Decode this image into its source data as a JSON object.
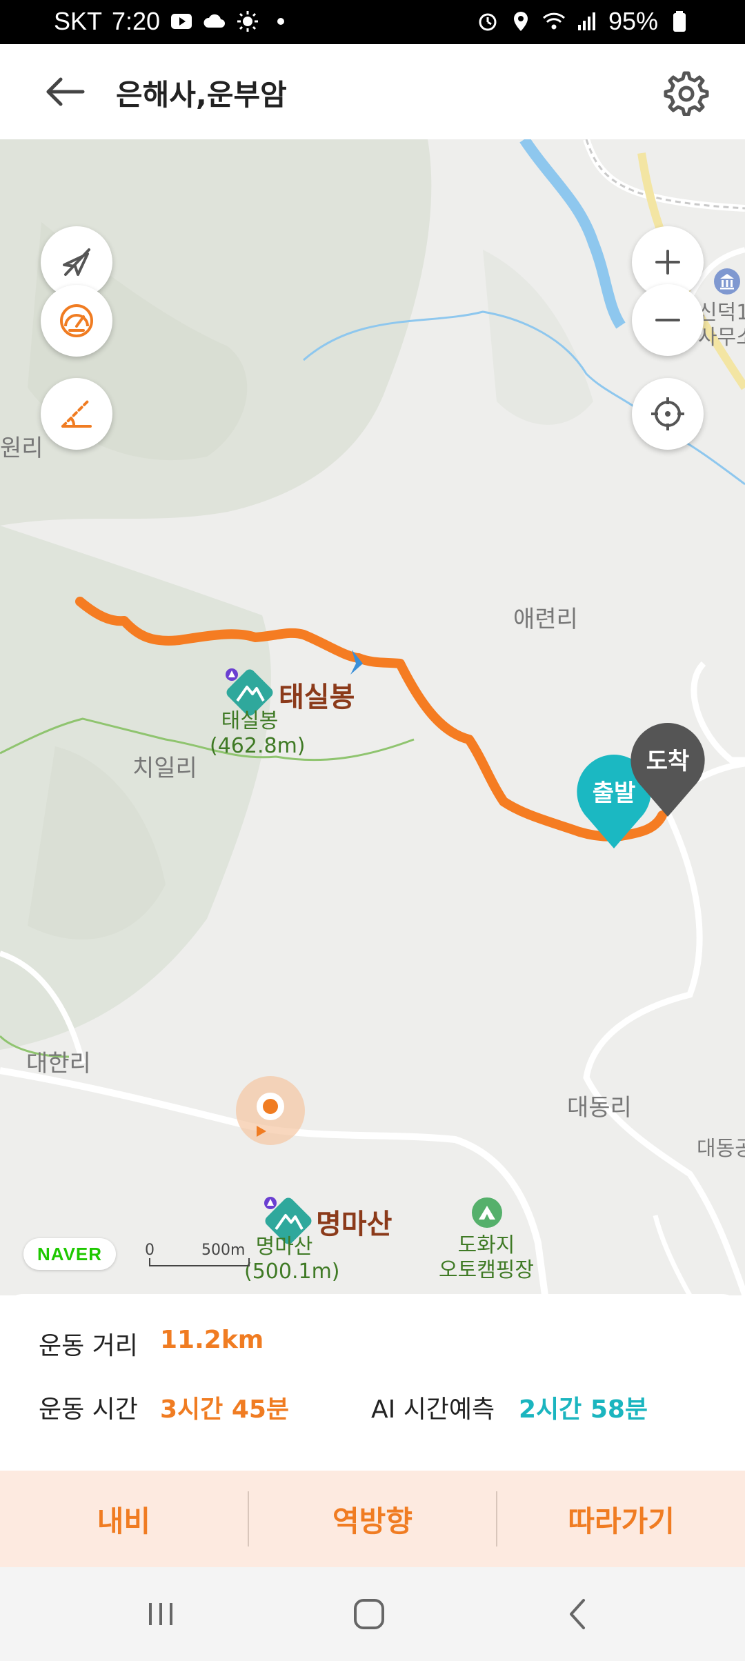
{
  "status_bar": {
    "carrier": "SKT",
    "time": "7:20",
    "battery": "95%",
    "icons": [
      "youtube-icon",
      "cloud-icon",
      "sun-icon",
      "dot-icon",
      "alarm-icon",
      "location-icon",
      "wifi-icon",
      "signal-icon",
      "battery-icon"
    ]
  },
  "header": {
    "title": "은해사,운부암",
    "back_icon": "arrow-left-icon",
    "settings_icon": "gear-icon"
  },
  "map": {
    "labels": {
      "aeryeon": "애련리",
      "chiil": "치일리",
      "daehan": "대한리",
      "daedong": "대동리",
      "won": "원리",
      "sindeok": "신덕1",
      "samuso": "사무소",
      "daedong_edge": "대동공"
    },
    "peaks": [
      {
        "name": "태실봉",
        "label": "태실봉",
        "elevation": "(462.8m)"
      },
      {
        "name": "명마산",
        "label": "명마산",
        "elevation": "(500.1m)"
      }
    ],
    "campsite": {
      "line1": "도화지",
      "line2": "오토캠핑장"
    },
    "markers": {
      "start": "출발",
      "arrival": "도착"
    },
    "controls_left": [
      "compass-off-icon",
      "speedometer-icon",
      "slope-icon"
    ],
    "controls_right": [
      "zoom-in-icon",
      "zoom-out-icon",
      "locate-icon"
    ],
    "logo": "NAVER",
    "scale": {
      "zero": "0",
      "distance": "500m"
    },
    "colors": {
      "route": "#f57c22",
      "start_pin": "#1bb8c2",
      "arrival_pin": "#555555",
      "water": "#8ec7ee"
    }
  },
  "stats": {
    "distance_label": "운동 거리",
    "distance_value": "11.2km",
    "time_label": "운동 시간",
    "time_value": "3시간 45분",
    "ai_label": "AI 시간예측",
    "ai_value": "2시간 58분",
    "colors": {
      "orange": "#f07c22",
      "teal": "#1bb5bf"
    }
  },
  "actions": {
    "navi": "내비",
    "reverse": "역방향",
    "follow": "따라가기"
  },
  "system_nav": [
    "recent-apps-icon",
    "home-icon",
    "back-icon"
  ]
}
